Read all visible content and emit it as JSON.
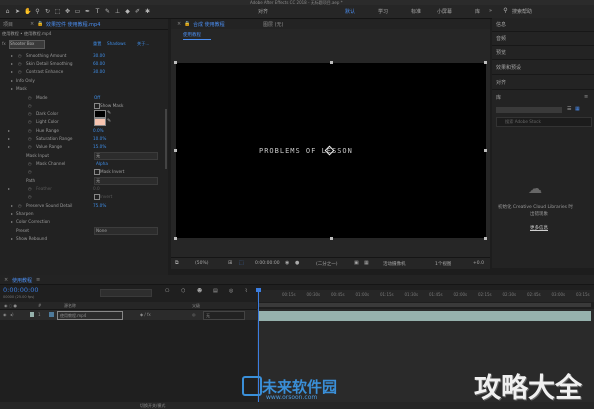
{
  "top_title": "Adobe After Effects CC 2018 - 无标题项目.aep *",
  "workspaces": {
    "items": [
      "默认",
      "学习",
      "标准",
      "小屏幕",
      "库"
    ],
    "active_index": 0,
    "search_label": "搜索帮助"
  },
  "tool_labels": {
    "align": "对齐"
  },
  "left_tabs": {
    "project": "项目",
    "effect_controls": "效果控件 使用教程.mp4"
  },
  "effect_controls": {
    "breadcrumb": "使用教程 • 使用教程.mp4",
    "effect_name": "Shooter Box",
    "reset": "重置",
    "about": "Shadows",
    "about2": "关于...",
    "rows": [
      {
        "name": "Smoothing Amount",
        "value": "30.00"
      },
      {
        "name": "Skin Detail Smoothing",
        "value": "60.00"
      },
      {
        "name": "Contrast Enhance",
        "value": "30.00"
      },
      {
        "name": "Info Only",
        "value": ""
      },
      {
        "name": "Mask",
        "value": ""
      },
      {
        "name": "Mode",
        "value": "Off"
      },
      {
        "name": "",
        "value": "Show Mask"
      },
      {
        "name": "Dark Color",
        "value": ""
      },
      {
        "name": "Light Color",
        "value": ""
      },
      {
        "name": "Hue Range",
        "value": "0.0%"
      },
      {
        "name": "Saturation Range",
        "value": "10.0%"
      },
      {
        "name": "Value Range",
        "value": "15.0%"
      },
      {
        "name": "Mask Input",
        "value": "无"
      },
      {
        "name": "Mask Channel",
        "value": "Alpha"
      },
      {
        "name": "",
        "value": "Mask Invert"
      },
      {
        "name": "Path",
        "value": "无"
      },
      {
        "name": "Feather",
        "value": "0.0"
      },
      {
        "name": "",
        "value": "Invert"
      },
      {
        "name": "Preserve Sound Detail",
        "value": "75.0%"
      },
      {
        "name": "Sharpen",
        "value": ""
      },
      {
        "name": "Color Correction",
        "value": ""
      },
      {
        "name": "Preset",
        "value": "None"
      },
      {
        "name": "Show Rebound",
        "value": ""
      }
    ]
  },
  "comp_tabs": {
    "composition": "合成 使用教程",
    "layer": "图层 (无)",
    "sub_tab": "使用教程"
  },
  "comp_bottom": {
    "zoom": "(50%)",
    "timecode": "0:00:00:00",
    "quality": "(二分之一)",
    "camera": "活动摄像机",
    "views": "1个视图",
    "plus": "+0.0"
  },
  "viewer_text": "PROBLEMS OF LESSON",
  "right_panel": {
    "items": [
      "信息",
      "音频",
      "预览",
      "效果和预设",
      "对齐",
      "库"
    ],
    "search_placeholder": "搜索 Adobe Stock",
    "cc_text_line1": "初始化 Creative Cloud Libraries 时",
    "cc_text_line2": "出错现象",
    "more_info": "更多信息"
  },
  "timeline": {
    "tab": "使用教程",
    "timecode": "0:00:00:00",
    "fps": "00000 (25.00 fps)",
    "col_source": "源名称",
    "col_parent": "父级",
    "layer_name": "使用教程.mp4",
    "layer_index": "1",
    "parent_value": "无",
    "bottom_toggle": "切换开关/模式",
    "ruler": [
      "00:15s",
      "00:30s",
      "00:45s",
      "01:00s",
      "01:15s",
      "01:30s",
      "01:45s",
      "02:00s",
      "02:15s",
      "02:30s",
      "02:45s",
      "03:00s",
      "03:15s"
    ]
  },
  "watermarks": {
    "site_cn": "未来软件园",
    "site_url": "www.orsoon.com",
    "corner": "攻略大全"
  },
  "colors": {
    "accent_blue": "#3b7de0",
    "track": "#96b2ad",
    "light_swatch": "#f7c4b0"
  }
}
